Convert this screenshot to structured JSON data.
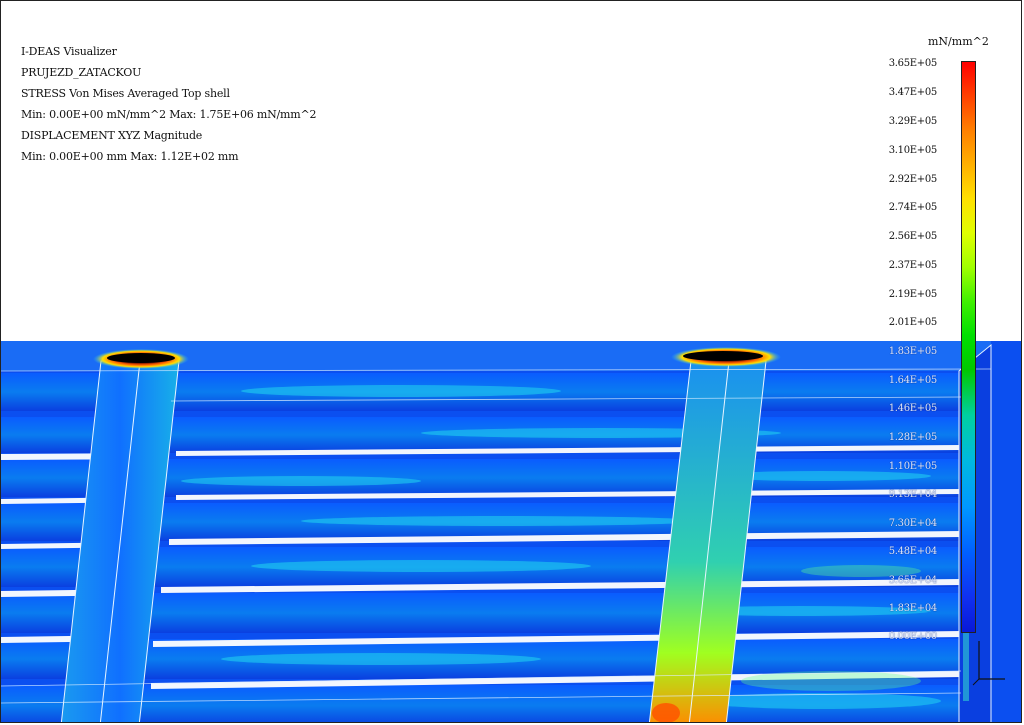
{
  "info": {
    "lines": [
      "I-DEAS Visualizer",
      "PRUJEZD_ZATACKOU",
      "STRESS  Von Mises  Averaged  Top shell",
      "Min: 0.00E+00 mN/mm^2  Max: 1.75E+06 mN/mm^2",
      "DISPLACEMENT  XYZ  Magnitude",
      "Min: 0.00E+00 mm  Max: 1.12E+02 mm"
    ]
  },
  "legend": {
    "unit": "mN/mm^2",
    "ticks": [
      "3.65E+05",
      "3.47E+05",
      "3.29E+05",
      "3.10E+05",
      "2.92E+05",
      "2.74E+05",
      "2.56E+05",
      "2.37E+05",
      "2.19E+05",
      "2.01E+05",
      "1.83E+05",
      "1.64E+05",
      "1.46E+05",
      "1.28E+05",
      "1.10E+05",
      "9.13E+04",
      "7.30E+04",
      "5.48E+04",
      "3.65E+04",
      "1.83E+04",
      "0.00E+00"
    ],
    "colors": {
      "max": "#ff0000",
      "mid": "#00e000",
      "min": "#0818d8"
    }
  },
  "model": {
    "icons": [
      "stress-contour-plot",
      "axis-triad-icon"
    ]
  }
}
